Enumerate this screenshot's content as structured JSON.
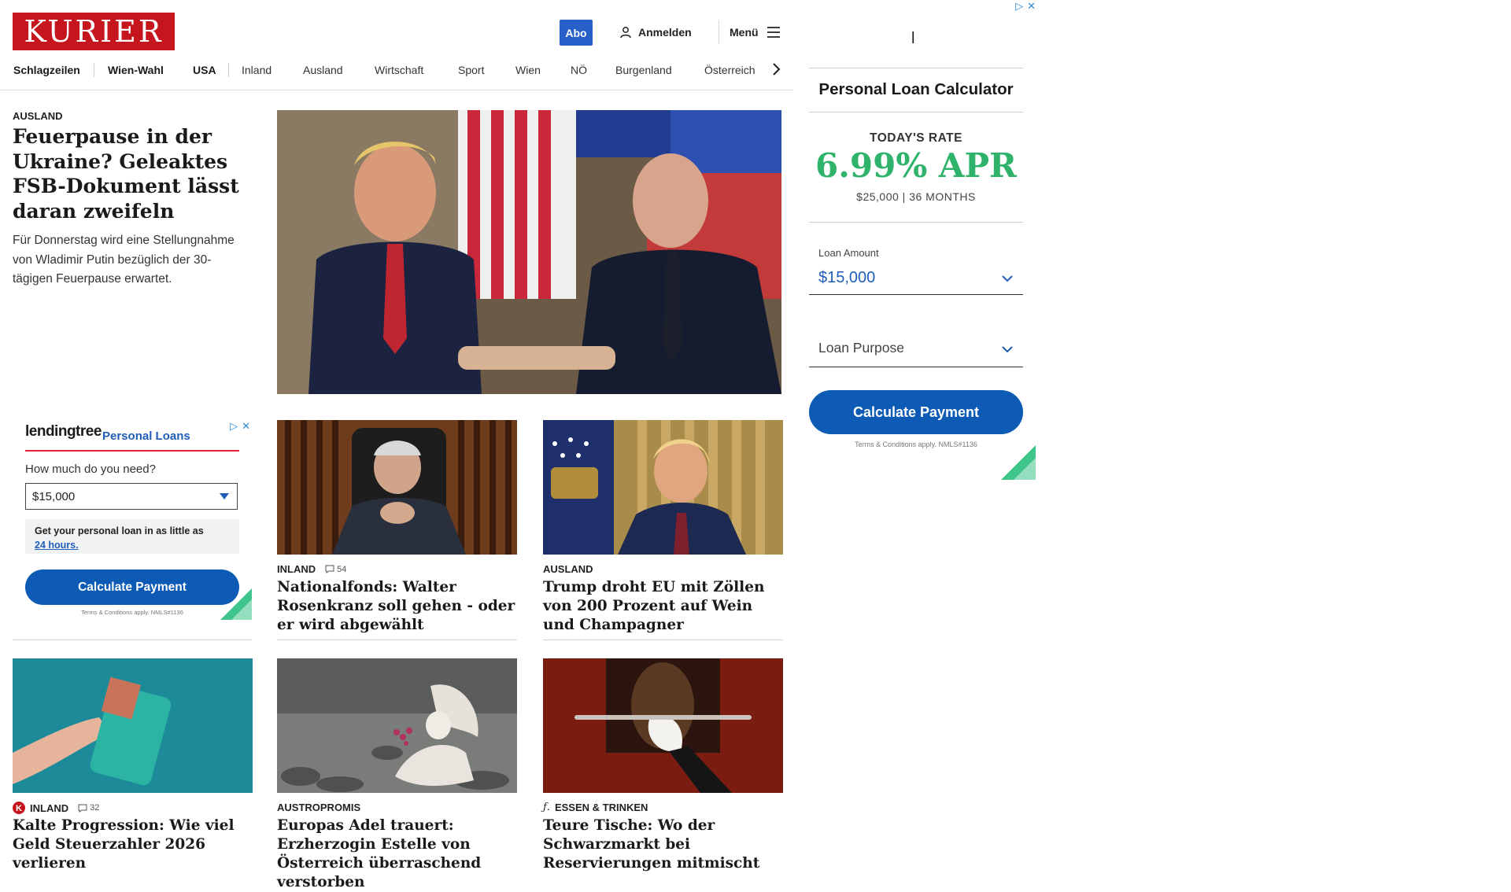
{
  "header": {
    "logo": "KURIER",
    "abo_label": "Abo",
    "login_label": "Anmelden",
    "menu_label": "Menü"
  },
  "nav": {
    "items": [
      {
        "label": "Schlagzeilen"
      },
      {
        "label": "Wien-Wahl"
      },
      {
        "label": "USA"
      },
      {
        "label": "Inland"
      },
      {
        "label": "Ausland"
      },
      {
        "label": "Wirtschaft"
      },
      {
        "label": "Sport"
      },
      {
        "label": "Wien"
      },
      {
        "label": "NÖ"
      },
      {
        "label": "Burgenland"
      },
      {
        "label": "Österreich"
      }
    ]
  },
  "lead": {
    "category": "AUSLAND",
    "title": "Feuerpause in der Ukraine? Geleaktes FSB-Dokument lässt daran zweifeln",
    "teaser": "Für Donnerstag wird eine Stellungnahme von Wladimir Putin bezüglich der 30-tägigen Feuerpause erwartet."
  },
  "ad_lendingtree": {
    "logo": "lendingtree",
    "product": "Personal Loans",
    "question": "How much do you need?",
    "select_value": "$15,000",
    "note_text": "Get your personal loan in as little as",
    "note_link": "24 hours.",
    "button": "Calculate Payment",
    "terms": "Terms & Conditions apply. NMLS#1136"
  },
  "cards": [
    {
      "category": "INLAND",
      "comments": "54",
      "title": "Nationalfonds: Walter Rosenkranz soll gehen - oder er wird abgewählt"
    },
    {
      "category": "AUSLAND",
      "comments": "",
      "title": "Trump droht EU mit Zöllen von 200 Prozent auf Wein und Champagner"
    },
    {
      "category": "INLAND",
      "comments": "32",
      "title": "Kalte Progression: Wie viel Geld Steuerzahler 2026 verlieren"
    },
    {
      "category": "AUSTROPROMIS",
      "comments": "",
      "title": "Europas Adel trauert: Erzherzogin Estelle von Österreich überraschend verstorben"
    },
    {
      "category": "ESSEN & TRINKEN",
      "comments": "",
      "title": "Teure Tische: Wo der Schwarzmarkt bei Reservierungen mitmischt"
    }
  ],
  "ad_calculator": {
    "mark": "l",
    "title": "Personal Loan Calculator",
    "rate_label": "TODAY'S RATE",
    "rate": "6.99% APR",
    "rate_sub": "$25,000 | 36 MONTHS",
    "amount_label": "Loan Amount",
    "amount_value": "$15,000",
    "purpose_placeholder": "Loan Purpose",
    "button": "Calculate Payment",
    "terms": "Terms & Conditions apply. NMLS#1136"
  },
  "colors": {
    "brand_red": "#c4161c",
    "abo_blue": "#2860c9",
    "ad_blue": "#0d5bb5",
    "rate_green": "#2fb36b"
  }
}
